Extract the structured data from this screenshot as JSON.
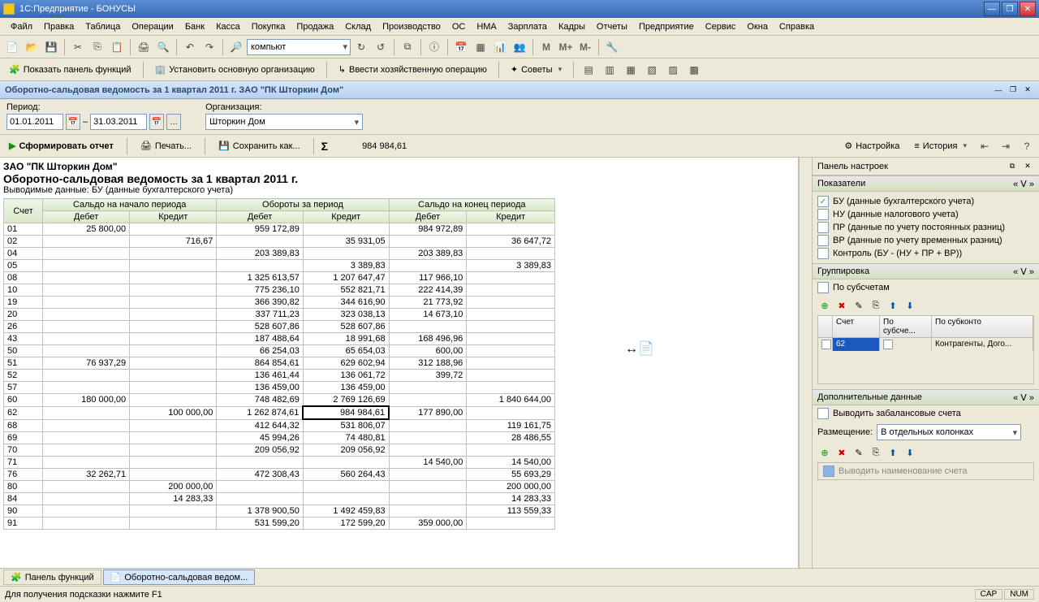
{
  "window": {
    "title": "1С:Предприятие - БОНУСЫ"
  },
  "menu": [
    "Файл",
    "Правка",
    "Таблица",
    "Операции",
    "Банк",
    "Касса",
    "Покупка",
    "Продажа",
    "Склад",
    "Производство",
    "ОС",
    "НМА",
    "Зарплата",
    "Кадры",
    "Отчеты",
    "Предприятие",
    "Сервис",
    "Окна",
    "Справка"
  ],
  "toolbar1": {
    "combo": "компьют",
    "m_buttons": [
      "M",
      "M+",
      "M-"
    ]
  },
  "toolbar2": {
    "btn1": "Показать панель функций",
    "btn2": "Установить основную организацию",
    "btn3": "Ввести хозяйственную операцию",
    "btn4": "Советы"
  },
  "doc_title": "Оборотно-сальдовая ведомость за 1 квартал 2011 г. ЗАО \"ПК Шторкин Дом\"",
  "params": {
    "period_label": "Период:",
    "from": "01.01.2011",
    "to": "31.03.2011",
    "org_label": "Организация:",
    "org": "Шторкин Дом"
  },
  "actions": {
    "form": "Сформировать отчет",
    "print": "Печать...",
    "save": "Сохранить как...",
    "sum_value": "984 984,61",
    "settings": "Настройка",
    "history": "История"
  },
  "report": {
    "title1": "ЗАО \"ПК Шторкин Дом\"",
    "title2": "Оборотно-сальдовая ведомость за 1 квартал 2011 г.",
    "subtitle": "Выводимые данные:  БУ (данные бухгалтерского учета)",
    "headers": {
      "acc": "Счет",
      "begin": "Сальдо на начало периода",
      "turn": "Обороты за период",
      "end": "Сальдо на конец периода",
      "debit": "Дебет",
      "credit": "Кредит"
    },
    "rows": [
      {
        "acc": "01",
        "bd": "25 800,00",
        "bc": "",
        "td": "959 172,89",
        "tc": "",
        "ed": "984 972,89",
        "ec": ""
      },
      {
        "acc": "02",
        "bd": "",
        "bc": "716,67",
        "td": "",
        "tc": "35 931,05",
        "ed": "",
        "ec": "36 647,72"
      },
      {
        "acc": "04",
        "bd": "",
        "bc": "",
        "td": "203 389,83",
        "tc": "",
        "ed": "203 389,83",
        "ec": ""
      },
      {
        "acc": "05",
        "bd": "",
        "bc": "",
        "td": "",
        "tc": "3 389,83",
        "ed": "",
        "ec": "3 389,83"
      },
      {
        "acc": "08",
        "bd": "",
        "bc": "",
        "td": "1 325 613,57",
        "tc": "1 207 647,47",
        "ed": "117 966,10",
        "ec": ""
      },
      {
        "acc": "10",
        "bd": "",
        "bc": "",
        "td": "775 236,10",
        "tc": "552 821,71",
        "ed": "222 414,39",
        "ec": ""
      },
      {
        "acc": "19",
        "bd": "",
        "bc": "",
        "td": "366 390,82",
        "tc": "344 616,90",
        "ed": "21 773,92",
        "ec": ""
      },
      {
        "acc": "20",
        "bd": "",
        "bc": "",
        "td": "337 711,23",
        "tc": "323 038,13",
        "ed": "14 673,10",
        "ec": ""
      },
      {
        "acc": "26",
        "bd": "",
        "bc": "",
        "td": "528 607,86",
        "tc": "528 607,86",
        "ed": "",
        "ec": ""
      },
      {
        "acc": "43",
        "bd": "",
        "bc": "",
        "td": "187 488,64",
        "tc": "18 991,68",
        "ed": "168 496,96",
        "ec": ""
      },
      {
        "acc": "50",
        "bd": "",
        "bc": "",
        "td": "66 254,03",
        "tc": "65 654,03",
        "ed": "600,00",
        "ec": ""
      },
      {
        "acc": "51",
        "bd": "76 937,29",
        "bc": "",
        "td": "864 854,61",
        "tc": "629 602,94",
        "ed": "312 188,96",
        "ec": ""
      },
      {
        "acc": "52",
        "bd": "",
        "bc": "",
        "td": "136 461,44",
        "tc": "136 061,72",
        "ed": "399,72",
        "ec": ""
      },
      {
        "acc": "57",
        "bd": "",
        "bc": "",
        "td": "136 459,00",
        "tc": "136 459,00",
        "ed": "",
        "ec": ""
      },
      {
        "acc": "60",
        "bd": "180 000,00",
        "bc": "",
        "td": "748 482,69",
        "tc": "2 769 126,69",
        "ed": "",
        "ec": "1 840 644,00"
      },
      {
        "acc": "62",
        "bd": "",
        "bc": "100 000,00",
        "td": "1 262 874,61",
        "tc": "984 984,61",
        "ed": "177 890,00",
        "ec": ""
      },
      {
        "acc": "68",
        "bd": "",
        "bc": "",
        "td": "412 644,32",
        "tc": "531 806,07",
        "ed": "",
        "ec": "119 161,75"
      },
      {
        "acc": "69",
        "bd": "",
        "bc": "",
        "td": "45 994,26",
        "tc": "74 480,81",
        "ed": "",
        "ec": "28 486,55"
      },
      {
        "acc": "70",
        "bd": "",
        "bc": "",
        "td": "209 056,92",
        "tc": "209 056,92",
        "ed": "",
        "ec": ""
      },
      {
        "acc": "71",
        "bd": "",
        "bc": "",
        "td": "",
        "tc": "",
        "ed": "14 540,00",
        "ec": "14 540,00"
      },
      {
        "acc": "76",
        "bd": "32 262,71",
        "bc": "",
        "td": "472 308,43",
        "tc": "560 264,43",
        "ed": "",
        "ec": "55 693,29"
      },
      {
        "acc": "80",
        "bd": "",
        "bc": "200 000,00",
        "td": "",
        "tc": "",
        "ed": "",
        "ec": "200 000,00"
      },
      {
        "acc": "84",
        "bd": "",
        "bc": "14 283,33",
        "td": "",
        "tc": "",
        "ed": "",
        "ec": "14 283,33"
      },
      {
        "acc": "90",
        "bd": "",
        "bc": "",
        "td": "1 378 900,50",
        "tc": "1 492 459,83",
        "ed": "",
        "ec": "113 559,33"
      },
      {
        "acc": "91",
        "bd": "",
        "bc": "",
        "td": "531 599,20",
        "tc": "172 599,20",
        "ed": "359 000,00",
        "ec": ""
      }
    ]
  },
  "settings": {
    "panel_title": "Панель настроек",
    "sec_indicators": "Показатели",
    "indicators": [
      {
        "checked": true,
        "label": "БУ (данные бухгалтерского учета)"
      },
      {
        "checked": false,
        "label": "НУ (данные налогового учета)"
      },
      {
        "checked": false,
        "label": "ПР (данные по учету постоянных разниц)"
      },
      {
        "checked": false,
        "label": "ВР (данные по учету временных разниц)"
      },
      {
        "checked": false,
        "label": "Контроль (БУ - (НУ + ПР + ВР))"
      }
    ],
    "sec_grouping": "Группировка",
    "by_sub": "По субсчетам",
    "grp_headers": [
      "Счет",
      "По субсче...",
      "По субконто"
    ],
    "grp_row": {
      "acc": "62",
      "sub": "",
      "subk": "Контрагенты, Дого..."
    },
    "sec_extra": "Дополнительные данные",
    "off_balance": "Выводить забалансовые счета",
    "placement_label": "Размещение:",
    "placement": "В отдельных колонках",
    "extra_check": "Выводить наименование счета"
  },
  "taskbar": {
    "btn1": "Панель функций",
    "btn2": "Оборотно-сальдовая ведом..."
  },
  "status": {
    "hint": "Для получения подсказки нажмите F1",
    "cap": "CAP",
    "num": "NUM"
  }
}
